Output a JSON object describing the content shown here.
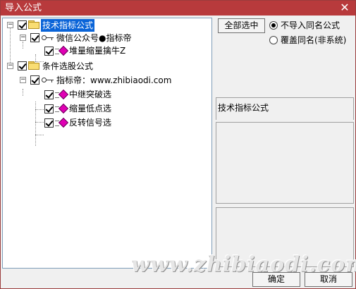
{
  "window": {
    "title": "导入公式",
    "close_symbol": "✕"
  },
  "tree": {
    "root1": {
      "label": "技术指标公式",
      "children": [
        {
          "label": "微信公众号●指标帝",
          "items": [
            {
              "label": "堆量缩量擒牛Z"
            }
          ]
        }
      ]
    },
    "root2": {
      "label": "条件选股公式",
      "children": [
        {
          "label": "指标帝：www.zhibiaodi.com",
          "items": [
            {
              "label": "中继突破选"
            },
            {
              "label": "缩量低点选"
            },
            {
              "label": "反转信号选"
            }
          ]
        }
      ]
    }
  },
  "controls": {
    "select_all": "全部选中",
    "options": [
      {
        "label": "不导入同名公式",
        "checked": true
      },
      {
        "label": "覆盖同名(非系统)",
        "checked": false
      }
    ],
    "panel_title": "技术指标公式",
    "ok": "确定",
    "cancel": "取消"
  },
  "watermark": "www.zhibiaodi.com",
  "icons": [
    "close-icon",
    "folder-icon",
    "key-icon",
    "formula-icon",
    "checkbox-icon",
    "expander-icon"
  ]
}
